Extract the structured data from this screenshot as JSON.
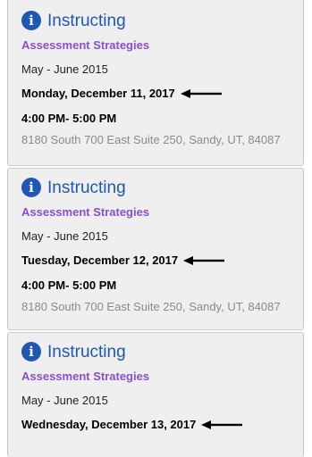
{
  "events": [
    {
      "role": "Instructing",
      "course": "Assessment Strategies",
      "term": "May - June 2015",
      "date": "Monday, December 11, 2017",
      "time": "4:00 PM- 5:00 PM",
      "address": "8180 South 700 East Suite 250, Sandy, UT, 84087"
    },
    {
      "role": "Instructing",
      "course": "Assessment Strategies",
      "term": "May - June 2015",
      "date": "Tuesday, December 12, 2017",
      "time": "4:00 PM- 5:00 PM",
      "address": "8180 South 700 East Suite 250, Sandy, UT, 84087"
    },
    {
      "role": "Instructing",
      "course": "Assessment Strategies",
      "term": "May - June 2015",
      "date": "Wednesday, December 13, 2017"
    }
  ],
  "icons": {
    "status": "info-icon",
    "annotation": "arrow-left-icon"
  },
  "colors": {
    "role": "#1f57b4",
    "course": "#8a4fd0",
    "address": "#8a8a8a",
    "card_background": "#efefef",
    "card_border": "#c8c8c8"
  }
}
